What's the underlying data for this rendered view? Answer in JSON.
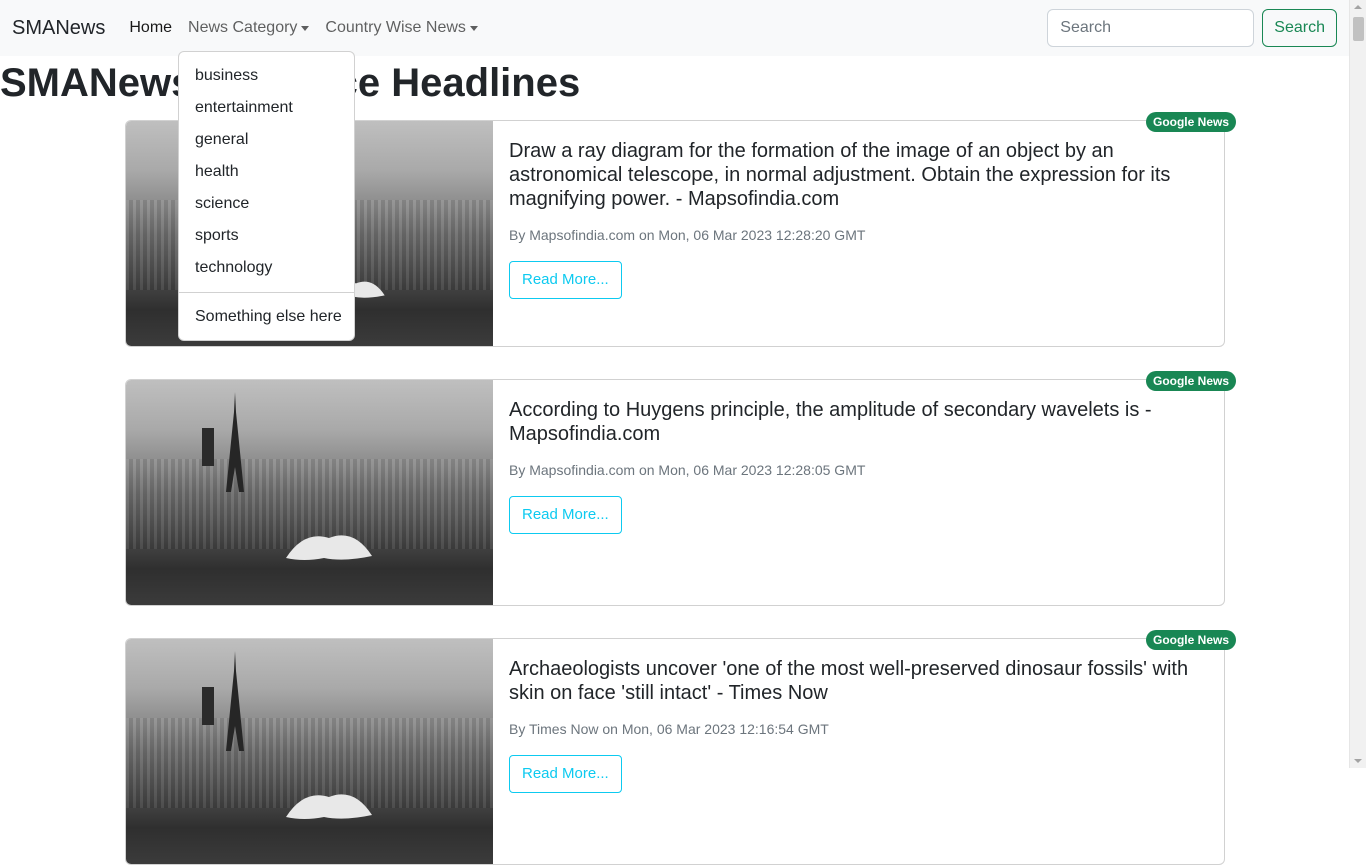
{
  "navbar": {
    "brand": "SMANews",
    "links": {
      "home": "Home",
      "news_category": "News Category",
      "country_wise_news": "Country Wise News"
    },
    "search_placeholder": "Search",
    "search_button": "Search"
  },
  "dropdown": {
    "items": [
      "business",
      "entertainment",
      "general",
      "health",
      "science",
      "sports",
      "technology"
    ],
    "extra_item": "Something else here"
  },
  "page_title": "SMANews - Science Headlines",
  "cards": [
    {
      "title": "Draw a ray diagram for the formation of the image of an object by an astronomical telescope, in normal adjustment. Obtain the expression for its magnifying power. - Mapsofindia.com",
      "meta": "By Mapsofindia.com on Mon, 06 Mar 2023 12:28:20 GMT",
      "button": "Read More...",
      "badge": "Google News"
    },
    {
      "title": "According to Huygens principle, the amplitude of secondary wavelets is - Mapsofindia.com",
      "meta": "By Mapsofindia.com on Mon, 06 Mar 2023 12:28:05 GMT",
      "button": "Read More...",
      "badge": "Google News"
    },
    {
      "title": "Archaeologists uncover 'one of the most well-preserved dinosaur fossils' with skin on face 'still intact' - Times Now",
      "meta": "By Times Now on Mon, 06 Mar 2023 12:16:54 GMT",
      "button": "Read More...",
      "badge": "Google News"
    }
  ],
  "colors": {
    "navbar_bg": "#f8f9fa",
    "success": "#198754",
    "info": "#0dcaf0",
    "muted": "#6c757d"
  }
}
